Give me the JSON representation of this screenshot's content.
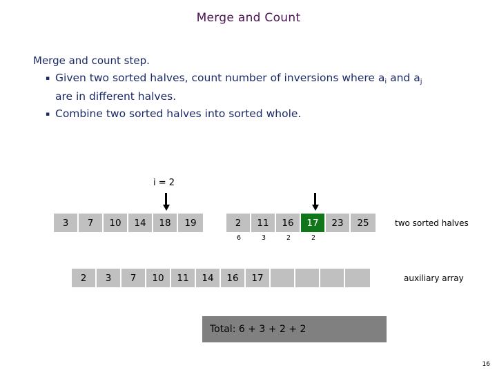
{
  "slide": {
    "title": "Merge and Count",
    "title_color": "#4a1352",
    "number": "16"
  },
  "body": {
    "lead": "Merge and count step.",
    "bullets": [
      {
        "marker": "▪",
        "text_part1": "Given two sorted halves, count number of inversions where a",
        "sub1": "i",
        "text_part2": " and a",
        "sub2": "j",
        "text_part3": "",
        "line2": "are in different halves."
      },
      {
        "marker": "▪",
        "text_part1": "Combine two sorted halves into sorted whole.",
        "sub1": "",
        "text_part2": "",
        "sub2": "",
        "text_part3": "",
        "line2": ""
      }
    ]
  },
  "diagram": {
    "pointer_label": "i = 2",
    "left_half": [
      "3",
      "7",
      "10",
      "14",
      "18",
      "19"
    ],
    "right_half": [
      "2",
      "11",
      "16",
      "17",
      "23",
      "25"
    ],
    "right_half_highlight_index": 3,
    "highlight_color": "#11761a",
    "cell_color": "#c0c0c0",
    "counts": [
      "6",
      "3",
      "2",
      "2"
    ],
    "aux_array": [
      "2",
      "3",
      "7",
      "10",
      "11",
      "14",
      "16",
      "17",
      "",
      "",
      "",
      ""
    ],
    "label_halves": "two sorted halves",
    "label_aux": "auxiliary array",
    "total_text": "Total:  6 + 3 + 2 + 2",
    "total_bg": "#808080"
  }
}
